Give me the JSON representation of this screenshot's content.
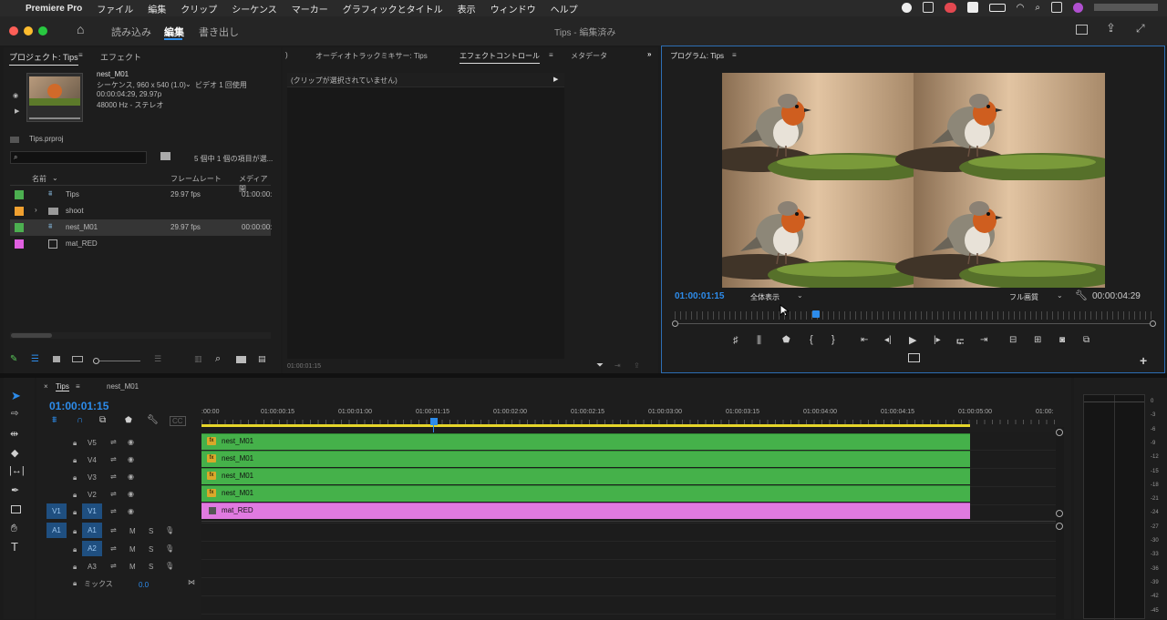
{
  "menubar": {
    "app_name": "Premiere Pro",
    "items": [
      "ファイル",
      "編集",
      "クリップ",
      "シーケンス",
      "マーカー",
      "グラフィックとタイトル",
      "表示",
      "ウィンドウ",
      "ヘルプ"
    ]
  },
  "appbar": {
    "workspaces": [
      "読み込み",
      "編集",
      "書き出し"
    ],
    "active_workspace": "編集",
    "title": "Tips - 編集済み"
  },
  "project_panel": {
    "tabs": [
      "プロジェクト: Tips",
      "エフェクト"
    ],
    "preview": {
      "name": "nest_M01",
      "line1": "シーケンス, 960 x 540 (1.0)",
      "usage": "ビデオ 1 回使用",
      "line2": "00:00:04:29, 29.97p",
      "line3": "48000 Hz - ステレオ"
    },
    "project_file": "Tips.prproj",
    "selection_info": "5 個中 1 個の項目が選...",
    "columns": [
      "名前",
      "フレームレート",
      "メディア開"
    ],
    "items": [
      {
        "name": "Tips",
        "fps": "29.97 fps",
        "media": "01:00:00:",
        "color": "#4caf50",
        "icon": "sequence-icon"
      },
      {
        "name": "shoot",
        "fps": "",
        "media": "",
        "color": "#f0a030",
        "icon": "folder-icon"
      },
      {
        "name": "nest_M01",
        "fps": "29.97 fps",
        "media": "00:00:00:",
        "color": "#4caf50",
        "icon": "sequence-icon"
      },
      {
        "name": "mat_RED",
        "fps": "",
        "media": "",
        "color": "#e060e0",
        "icon": "matte-icon"
      }
    ]
  },
  "effect_panel": {
    "tabs": [
      "オーディオトラックミキサー: Tips",
      "エフェクトコントロール",
      "メタデータ"
    ],
    "no_clip": "(クリップが選択されていません)",
    "timecode": "01:00:01:15"
  },
  "program_monitor": {
    "title": "プログラム: Tips",
    "current_tc": "01:00:01:15",
    "zoom": "全体表示",
    "quality": "フル画質",
    "duration_tc": "00:00:04:29",
    "playhead_fraction": 0.295
  },
  "timeline": {
    "tabs": [
      "Tips",
      "nest_M01"
    ],
    "timecode": "01:00:01:15",
    "ruler": [
      ":00:00",
      "01:00:00:15",
      "01:00:01:00",
      "01:00:01:15",
      "01:00:02:00",
      "01:00:02:15",
      "01:00:03:00",
      "01:00:03:15",
      "01:00:04:00",
      "01:00:04:15",
      "01:00:05:00",
      "01:00:"
    ],
    "video_tracks": [
      "V5",
      "V4",
      "V3",
      "V2",
      "V1"
    ],
    "audio_tracks": [
      "A1",
      "A2",
      "A3"
    ],
    "source_v": "V1",
    "source_a": "A1",
    "clips": [
      {
        "label": "nest_M01",
        "fx": "fx"
      },
      {
        "label": "nest_M01",
        "fx": "fx"
      },
      {
        "label": "nest_M01",
        "fx": "fx"
      },
      {
        "label": "nest_M01",
        "fx": "fx"
      },
      {
        "label": "mat_RED",
        "fx": ""
      }
    ],
    "mix_label": "ミックス",
    "mix_value": "0.0",
    "m": "M",
    "s": "S"
  },
  "meter": {
    "scale": [
      "0",
      "-3",
      "-6",
      "-9",
      "-12",
      "-15",
      "-18",
      "-21",
      "-24",
      "-27",
      "-30",
      "-33",
      "-36",
      "-39",
      "-42",
      "-45"
    ]
  },
  "colors": {
    "accent": "#2d8ceb",
    "clip_green": "#45b14a",
    "clip_pink": "#e07ae0"
  }
}
